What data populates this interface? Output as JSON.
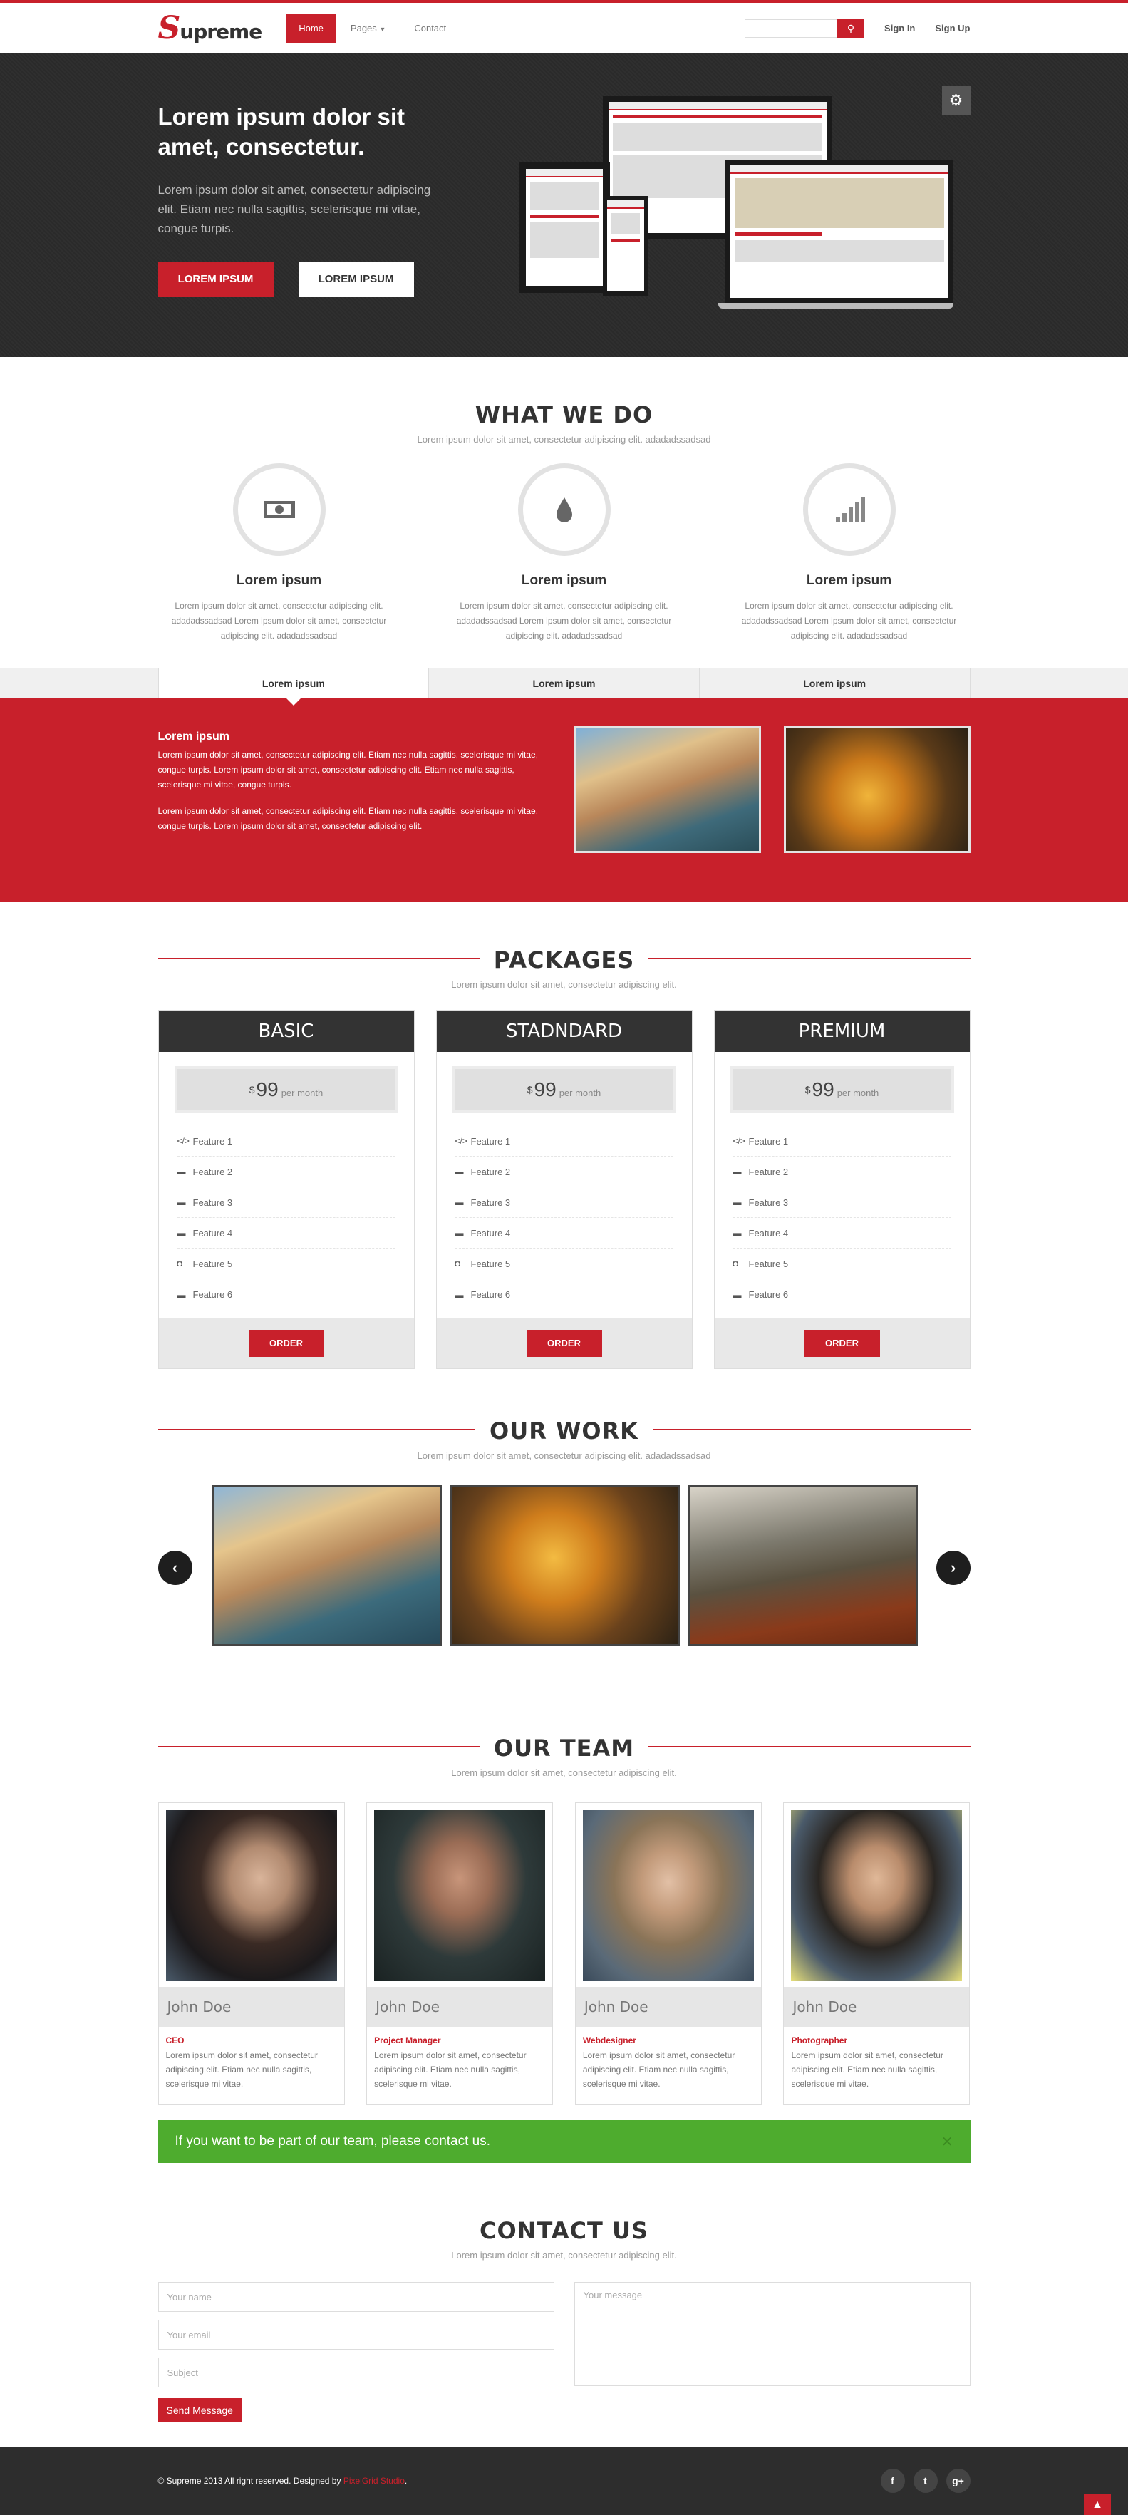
{
  "nav": {
    "logo_initial": "S",
    "logo_rest": "upreme",
    "items": [
      {
        "label": "Home"
      },
      {
        "label": "Pages"
      },
      {
        "label": "Contact"
      }
    ],
    "search_placeholder": "",
    "signin": "Sign In",
    "signup": "Sign Up"
  },
  "hero": {
    "title": "Lorem ipsum dolor sit amet, consectetur.",
    "text": "Lorem ipsum dolor sit amet, consectetur adipiscing elit. Etiam nec nulla sagittis, scelerisque mi vitae, congue turpis.",
    "primary_button": "LOREM IPSUM",
    "secondary_button": "LOREM IPSUM"
  },
  "what_we_do": {
    "title": "WHAT WE DO",
    "subtitle": "Lorem ipsum dolor sit amet, consectetur adipiscing elit. adadadssadsad",
    "features": [
      {
        "icon": "money-icon",
        "title": "Lorem ipsum",
        "text": "Lorem ipsum dolor sit amet, consectetur adipiscing elit. adadadssadsad Lorem ipsum dolor sit amet, consectetur adipiscing elit. adadadssadsad"
      },
      {
        "icon": "drop-icon",
        "title": "Lorem ipsum",
        "text": "Lorem ipsum dolor sit amet, consectetur adipiscing elit. adadadssadsad Lorem ipsum dolor sit amet, consectetur adipiscing elit. adadadssadsad"
      },
      {
        "icon": "signal-icon",
        "title": "Lorem ipsum",
        "text": "Lorem ipsum dolor sit amet, consectetur adipiscing elit. adadadssadsad Lorem ipsum dolor sit amet, consectetur adipiscing elit. adadadssadsad"
      }
    ]
  },
  "tabs": {
    "items": [
      {
        "label": "Lorem ipsum"
      },
      {
        "label": "Lorem ipsum"
      },
      {
        "label": "Lorem ipsum"
      }
    ],
    "panel_title": "Lorem ipsum",
    "panel_p1": "Lorem ipsum dolor sit amet, consectetur adipiscing elit. Etiam nec nulla sagittis, scelerisque mi vitae, congue turpis. Lorem ipsum dolor sit amet, consectetur adipiscing elit. Etiam nec nulla sagittis, scelerisque mi vitae, congue turpis.",
    "panel_p2": "Lorem ipsum dolor sit amet, consectetur adipiscing elit. Etiam nec nulla sagittis, scelerisque mi vitae, congue turpis. Lorem ipsum dolor sit amet, consectetur adipiscing elit."
  },
  "packages": {
    "title": "PACKAGES",
    "subtitle": "Lorem ipsum dolor sit amet, consectetur adipiscing elit.",
    "items": [
      {
        "name": "BASIC",
        "currency": "$",
        "price": "99",
        "period": "per month",
        "features": [
          "Feature 1",
          "Feature 2",
          "Feature 3",
          "Feature 4",
          "Feature 5",
          "Feature 6"
        ],
        "button": "ORDER"
      },
      {
        "name": "STADNDARD",
        "currency": "$",
        "price": "99",
        "period": "per month",
        "features": [
          "Feature 1",
          "Feature 2",
          "Feature 3",
          "Feature 4",
          "Feature 5",
          "Feature 6"
        ],
        "button": "ORDER"
      },
      {
        "name": "PREMIUM",
        "currency": "$",
        "price": "99",
        "period": "per month",
        "features": [
          "Feature 1",
          "Feature 2",
          "Feature 3",
          "Feature 4",
          "Feature 5",
          "Feature 6"
        ],
        "button": "ORDER"
      }
    ]
  },
  "work": {
    "title": "OUR WORK",
    "subtitle": "Lorem ipsum dolor sit amet, consectetur adipiscing elit. adadadssadsad"
  },
  "team": {
    "title": "OUR TEAM",
    "subtitle": "Lorem ipsum dolor sit amet, consectetur adipiscing elit.",
    "members": [
      {
        "name": "John Doe",
        "role": "CEO",
        "text": "Lorem ipsum dolor sit amet, consectetur adipiscing elit. Etiam nec nulla sagittis, scelerisque mi vitae."
      },
      {
        "name": "John Doe",
        "role": "Project Manager",
        "text": "Lorem ipsum dolor sit amet, consectetur adipiscing elit. Etiam nec nulla sagittis, scelerisque mi vitae."
      },
      {
        "name": "John Doe",
        "role": "Webdesigner",
        "text": "Lorem ipsum dolor sit amet, consectetur adipiscing elit. Etiam nec nulla sagittis, scelerisque mi vitae."
      },
      {
        "name": "John Doe",
        "role": "Photographer",
        "text": "Lorem ipsum dolor sit amet, consectetur adipiscing elit. Etiam nec nulla sagittis, scelerisque mi vitae."
      }
    ],
    "alert": "If you want to be part of our team, please contact us."
  },
  "contact": {
    "title": "CONTACT US",
    "subtitle": "Lorem ipsum dolor sit amet, consectetur adipiscing elit.",
    "name_placeholder": "Your name",
    "email_placeholder": "Your email",
    "subject_placeholder": "Subject",
    "message_placeholder": "Your message",
    "send": "Send Message"
  },
  "footer": {
    "copy": "© Supreme 2013 All right reserved. Designed by ",
    "studio": "PixelGrid Studio",
    "end": "."
  },
  "colors": {
    "accent": "#c8202b",
    "dark": "#2b2b2b",
    "success": "#4eac2e"
  }
}
